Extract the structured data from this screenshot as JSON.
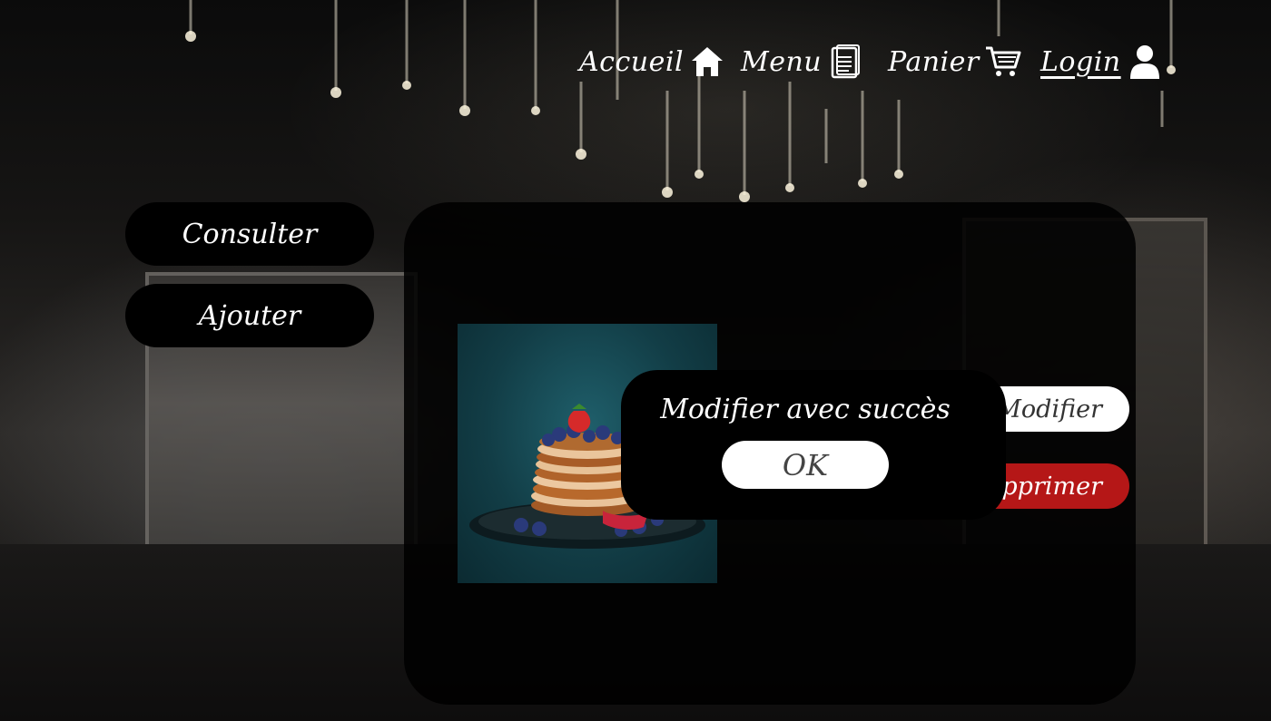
{
  "nav": {
    "items": [
      {
        "label": "Accueil",
        "icon": "home-icon"
      },
      {
        "label": "Menu",
        "icon": "menu-card-icon"
      },
      {
        "label": "Panier",
        "icon": "cart-icon"
      },
      {
        "label": "Login",
        "icon": "user-icon"
      }
    ]
  },
  "sidebar": {
    "consulter_label": "Consulter",
    "ajouter_label": "Ajouter"
  },
  "product": {
    "image_icon": "pancakes-photo",
    "modifier_label": "Modifier",
    "supprimer_label": "Supprimer"
  },
  "modal": {
    "message": "Modifier avec succès",
    "ok_label": "OK"
  },
  "colors": {
    "supprimer": "#b51717",
    "panel": "#000000",
    "button_light": "#ffffff"
  }
}
